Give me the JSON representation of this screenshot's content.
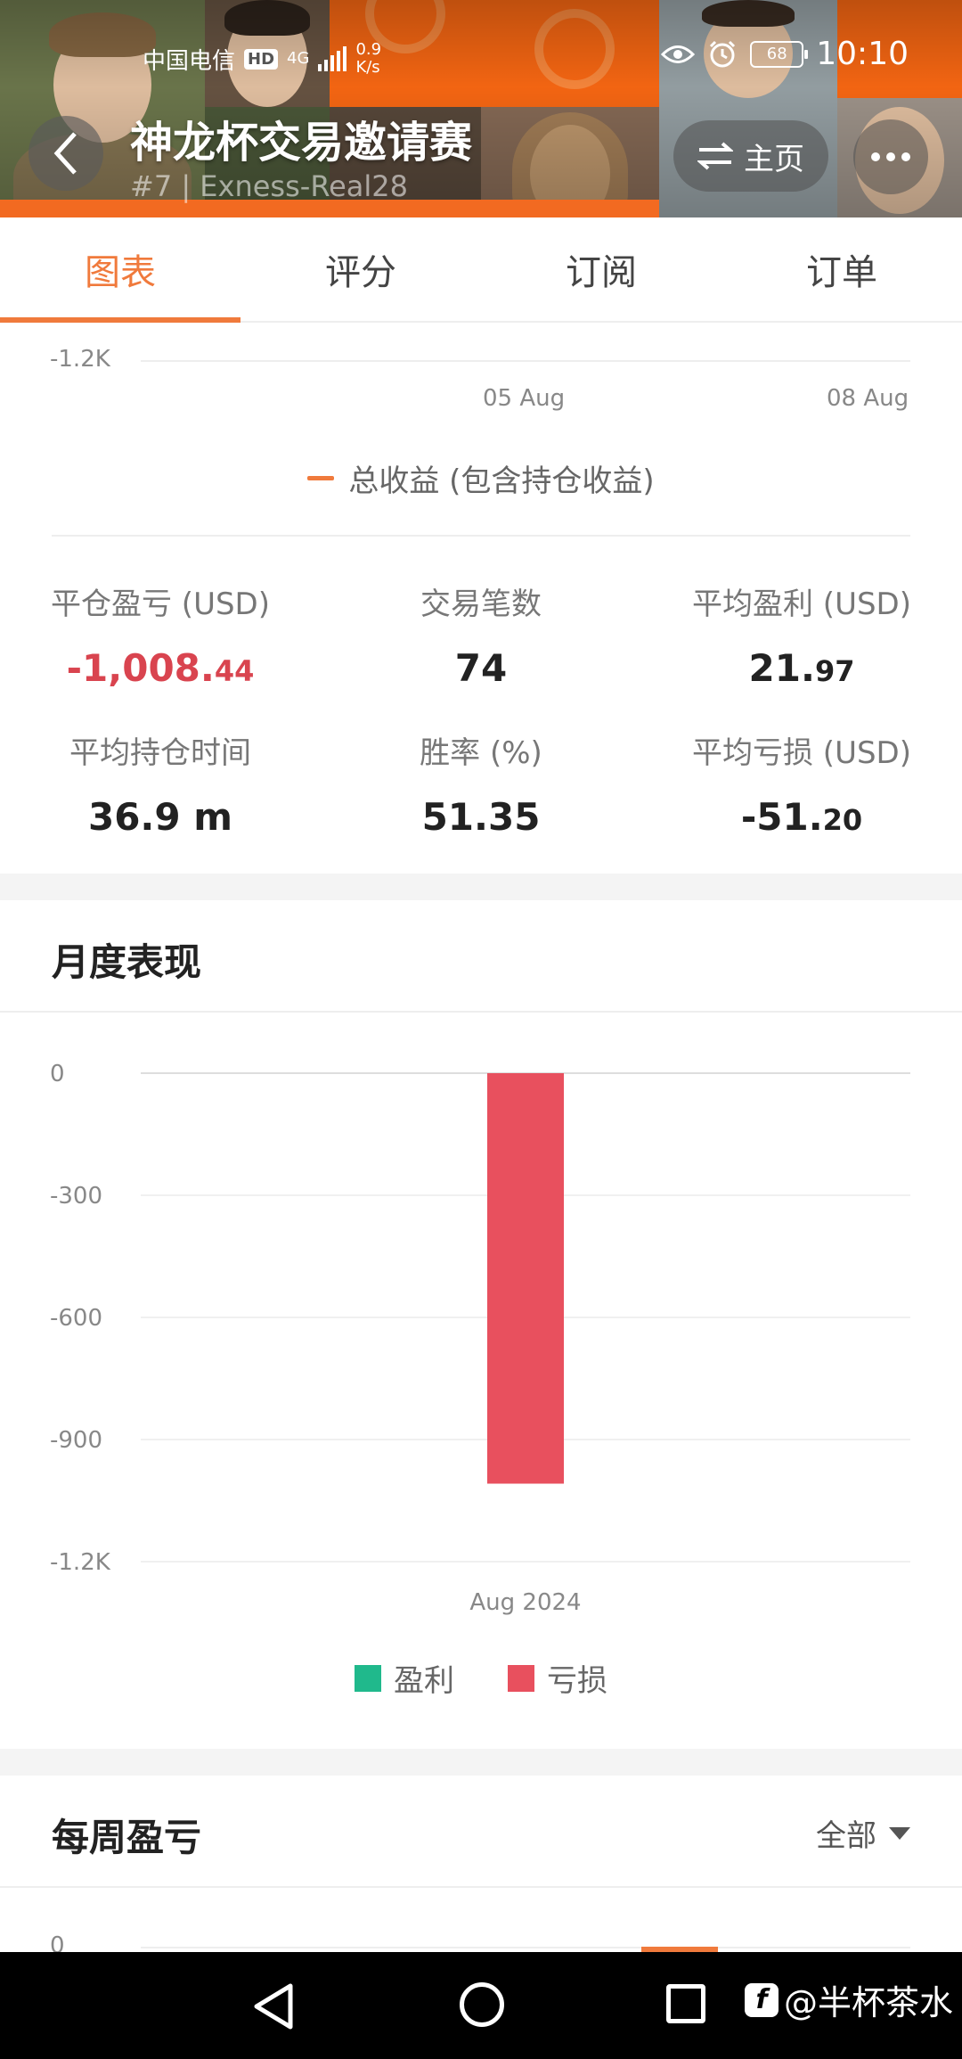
{
  "status": {
    "carrier": "中国电信",
    "hd": "HD",
    "network": "4G",
    "speed_value": "0.9",
    "speed_unit": "K/s",
    "battery": "68",
    "time": "10:10"
  },
  "header": {
    "title": "神龙杯交易邀请赛",
    "subtitle": "#7 | Exness-Real28",
    "home_label": "主页"
  },
  "tabs": [
    {
      "label": "图表",
      "active": true
    },
    {
      "label": "评分",
      "active": false
    },
    {
      "label": "订阅",
      "active": false
    },
    {
      "label": "订单",
      "active": false
    }
  ],
  "equity_chart": {
    "visible_y_tick": "-1.2K",
    "x_ticks": [
      "05 Aug",
      "08 Aug"
    ],
    "legend": "总收益 (包含持仓收益)",
    "line_color": "#f07a3c"
  },
  "stats": [
    {
      "label": "平仓盈亏 (USD)",
      "int": "-1,008.",
      "dec": "44",
      "negative": true
    },
    {
      "label": "交易笔数",
      "int": "74",
      "dec": "",
      "negative": false
    },
    {
      "label": "平均盈利 (USD)",
      "int": "21.",
      "dec": "97",
      "negative": false
    },
    {
      "label": "平均持仓时间",
      "int": "36.9 m",
      "dec": "",
      "negative": false
    },
    {
      "label": "胜率 (%)",
      "int": "51.35",
      "dec": "",
      "negative": false
    },
    {
      "label": "平均亏损 (USD)",
      "int": "-51.",
      "dec": "20",
      "negative": false
    }
  ],
  "monthly": {
    "title": "月度表现",
    "legend": [
      {
        "label": "盈利",
        "color": "#20b98c"
      },
      {
        "label": "亏损",
        "color": "#e8505e"
      }
    ]
  },
  "chart_data": {
    "type": "bar",
    "categories": [
      "Aug 2024"
    ],
    "series": [
      {
        "name": "盈利",
        "values": [
          0
        ],
        "color": "#20b98c"
      },
      {
        "name": "亏损",
        "values": [
          -1008.44
        ],
        "color": "#e8505e"
      }
    ],
    "y_ticks": [
      "0",
      "-300",
      "-600",
      "-900",
      "-1.2K"
    ],
    "ylim": [
      -1200,
      0
    ],
    "grid": true,
    "legend_position": "bottom"
  },
  "weekly": {
    "title": "每周盈亏",
    "filter_label": "全部",
    "first_y_tick": "0"
  },
  "watermark": "@半杯茶水"
}
